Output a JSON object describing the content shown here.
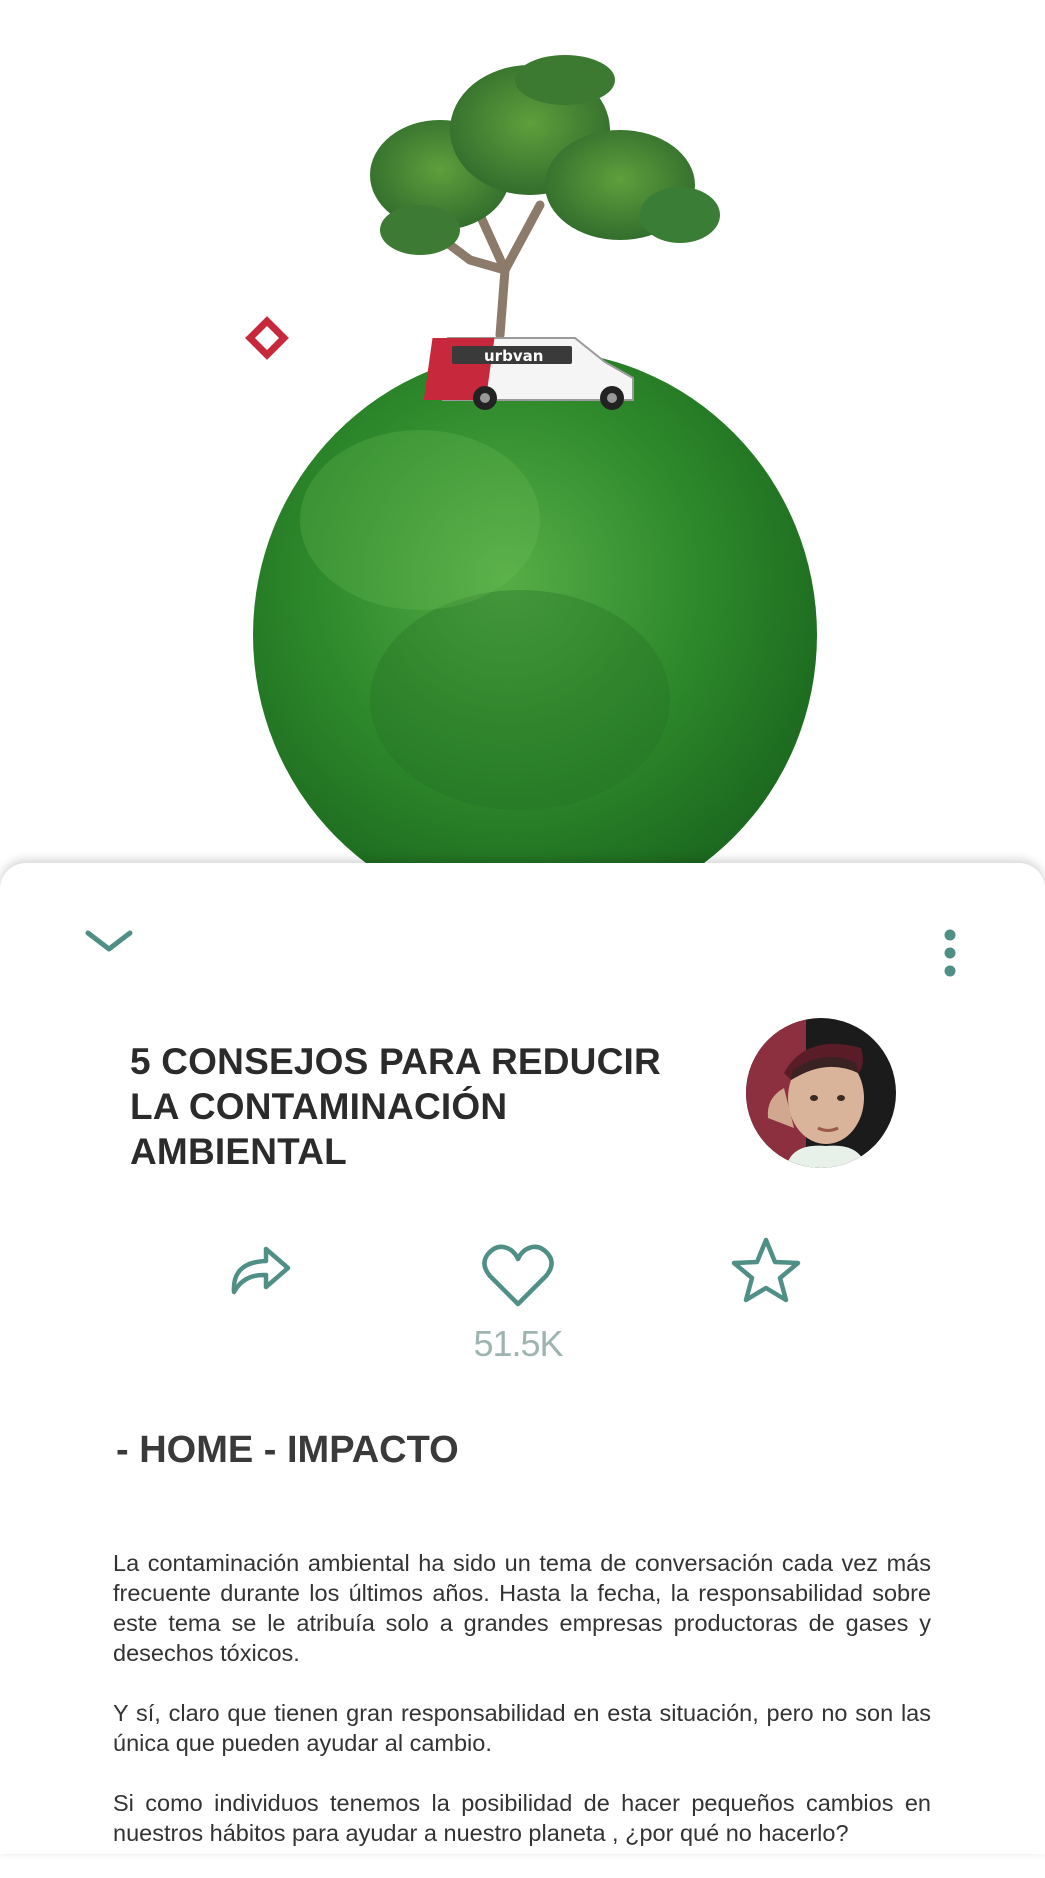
{
  "hero": {
    "van_label": "urbvan",
    "icons": [
      "diamond-marker",
      "tree",
      "van",
      "grass-globe"
    ]
  },
  "header": {
    "collapse_icon": "chevron-down-icon",
    "more_icon": "vertical-dots-icon"
  },
  "article": {
    "title": "5 CONSEJOS PARA REDUCIR LA CONTAMINACIÓN AMBIENTAL",
    "breadcrumb": "- HOME - IMPACTO",
    "paragraphs": [
      "La contaminación ambiental ha sido un tema de conversación cada vez más frecuente durante los últimos años. Hasta la fecha, la responsabilidad sobre este tema se le atribuía solo a grandes empresas productoras de gases y desechos tóxicos.",
      "Y sí, claro que tienen gran responsabilidad en esta situación, pero no son las única que pueden ayudar al cambio.",
      "Si como individuos tenemos la posibilidad de hacer pequeños cambios en nuestros hábitos para ayudar a nuestro planeta , ¿por qué no hacerlo?"
    ]
  },
  "actions": {
    "share_icon": "share-icon",
    "like_icon": "heart-icon",
    "likes_count": "51.5K",
    "favorite_icon": "star-icon"
  },
  "colors": {
    "accent": "#4f8f86",
    "likes_text": "#9fb4b1",
    "title_text": "#2b2b2b",
    "brand_red": "#c8283c",
    "grass_green": "#3f9a3a"
  }
}
